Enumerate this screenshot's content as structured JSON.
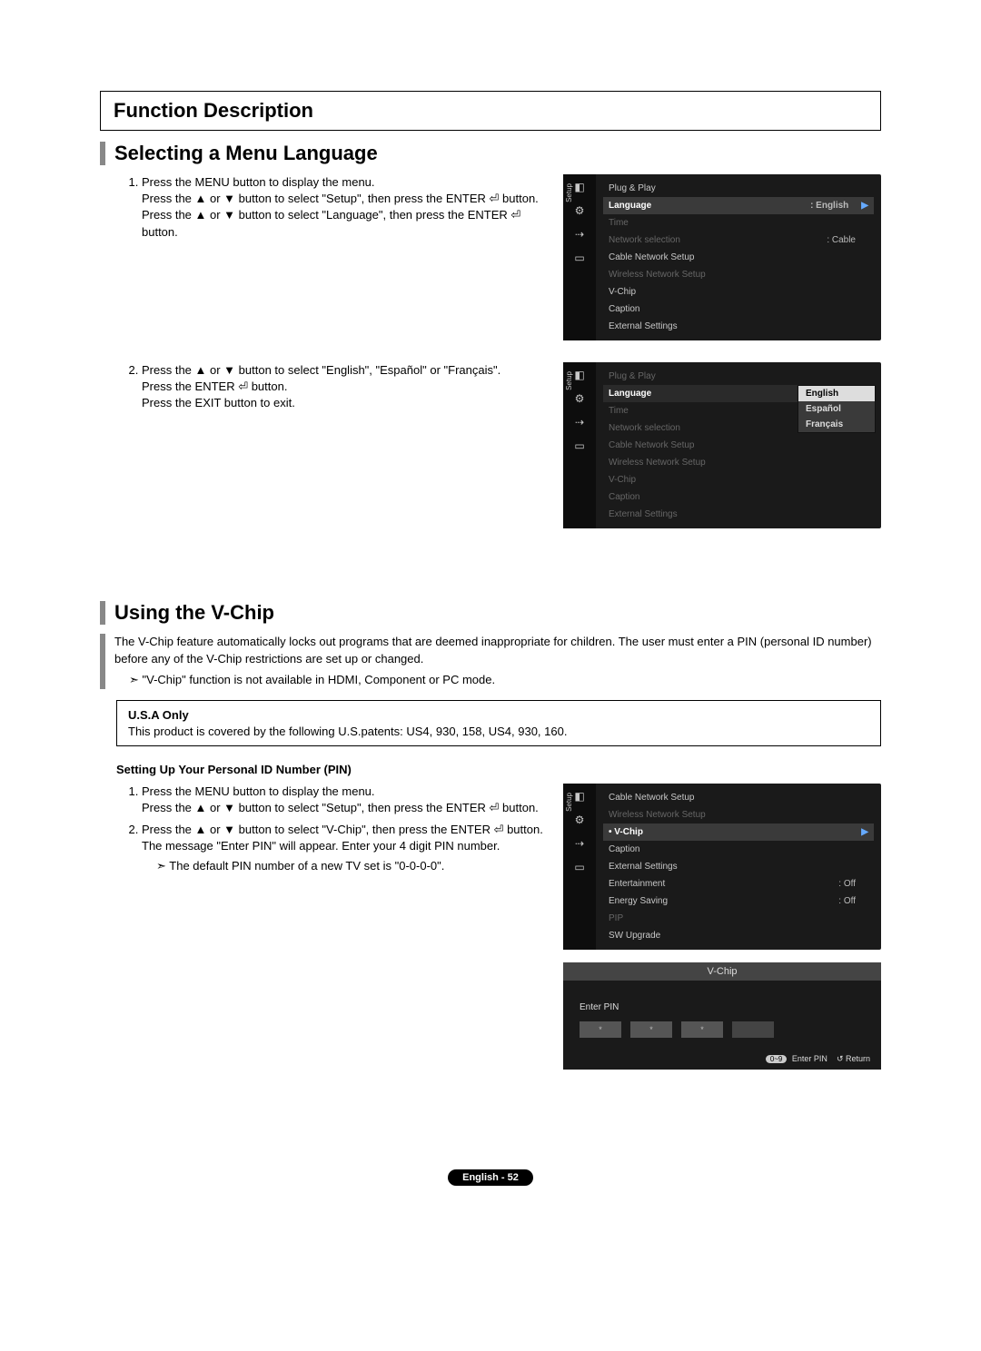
{
  "title": "Function Description",
  "section1": {
    "heading": "Selecting a Menu Language",
    "step1": "Press the MENU button to display the menu.\nPress the ▲ or ▼ button to select \"Setup\", then press the ENTER ⏎ button.\nPress the ▲ or ▼ button to select \"Language\", then press the ENTER ⏎ button.",
    "step2": "Press the ▲ or ▼ button to select \"English\", \"Español\" or \"Français\".\nPress the ENTER ⏎ button.\nPress the EXIT button to exit."
  },
  "section2": {
    "heading": "Using the V-Chip",
    "desc": "The V-Chip feature automatically locks out programs that are deemed inappropriate for children. The user must enter a PIN (personal ID number) before any of the V-Chip restrictions are set up or changed.",
    "note": "\"V-Chip\" function is not available in HDMI, Component or PC mode.",
    "usa_title": "U.S.A Only",
    "usa_body": "This product is covered by the following U.S.patents: US4, 930, 158, US4, 930, 160.",
    "sub_heading": "Setting Up Your Personal ID Number (PIN)",
    "step1": "Press the MENU button to display the menu.\nPress the ▲ or ▼ button to select \"Setup\", then press the ENTER ⏎ button.",
    "step2": "Press the ▲ or ▼ button to select \"V-Chip\", then press the ENTER ⏎ button.\nThe message \"Enter PIN\" will appear. Enter your 4 digit PIN number.",
    "step2_note": "The default PIN number of a new TV set is \"0-0-0-0\"."
  },
  "osd1": {
    "side": "Setup",
    "items": [
      "Plug & Play",
      "Language",
      "Time",
      "Network selection",
      "Cable Network Setup",
      "Wireless Network Setup",
      "V-Chip",
      "Caption",
      "External Settings"
    ],
    "lang_val": ": English",
    "net_val": ": Cable"
  },
  "osd2": {
    "side": "Setup",
    "items": [
      "Plug & Play",
      "Language",
      "Time",
      "Network selection",
      "Cable Network Setup",
      "Wireless Network Setup",
      "V-Chip",
      "Caption",
      "External Settings"
    ],
    "popup": [
      "English",
      "Español",
      "Français"
    ]
  },
  "osd3": {
    "side": "Setup",
    "items": [
      "Cable Network Setup",
      "Wireless Network Setup",
      "V-Chip",
      "Caption",
      "External Settings",
      "Entertainment",
      "Energy Saving",
      "PIP",
      "SW Upgrade"
    ],
    "ent_val": ": Off",
    "energy_val": ": Off"
  },
  "vchip": {
    "title": "V-Chip",
    "enter": "Enter PIN",
    "dots": "*",
    "foot_pill": "0~9",
    "foot1": "Enter PIN",
    "foot2": "↺ Return"
  },
  "footer": "English - 52"
}
